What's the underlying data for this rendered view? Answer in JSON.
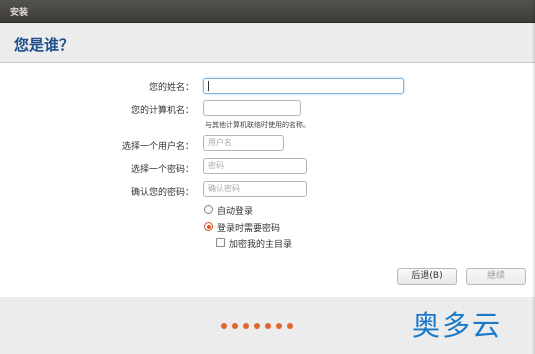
{
  "window": {
    "title": "安装"
  },
  "page": {
    "heading": "您是谁？"
  },
  "form": {
    "name_label": "您的姓名：",
    "name_value": "",
    "computer_label": "您的计算机名：",
    "computer_value": "",
    "computer_hint": "与其他计算机联络时使用的名称。",
    "username_label": "选择一个用户名：",
    "username_placeholder": "用户名",
    "password_label": "选择一个密码：",
    "password_placeholder": "密码",
    "confirm_label": "确认您的密码：",
    "confirm_placeholder": "确认密码"
  },
  "login_options": {
    "auto_login": "自动登录",
    "require_password": "登录时需要密码",
    "selected": "require_password",
    "encrypt_home": "加密我的主目录",
    "encrypt_checked": false
  },
  "buttons": {
    "back": "后退(B)",
    "continue": "继续"
  },
  "progress": {
    "dot_count": 7
  },
  "watermark": "奥多云",
  "colors": {
    "accent": "#e0672e",
    "heading": "#1e4f8a",
    "watermark": "#1679c9"
  }
}
